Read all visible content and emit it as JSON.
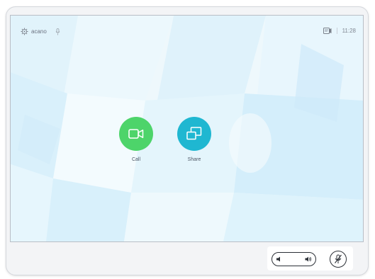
{
  "brand": {
    "name": "acano",
    "logo_icon": "gear-logo-icon",
    "mic_icon": "microphone-icon"
  },
  "status": {
    "camera_icon": "camera-status-icon",
    "time": "11:28"
  },
  "actions": [
    {
      "label": "Call",
      "icon": "video-camera-icon",
      "color": "#4dd46a"
    },
    {
      "label": "Share",
      "icon": "share-screen-icon",
      "color": "#1fb7d1"
    }
  ],
  "controls": {
    "volume_down_icon": "volume-down-icon",
    "volume_up_icon": "volume-up-icon",
    "mute_icon": "microphone-muted-icon"
  }
}
